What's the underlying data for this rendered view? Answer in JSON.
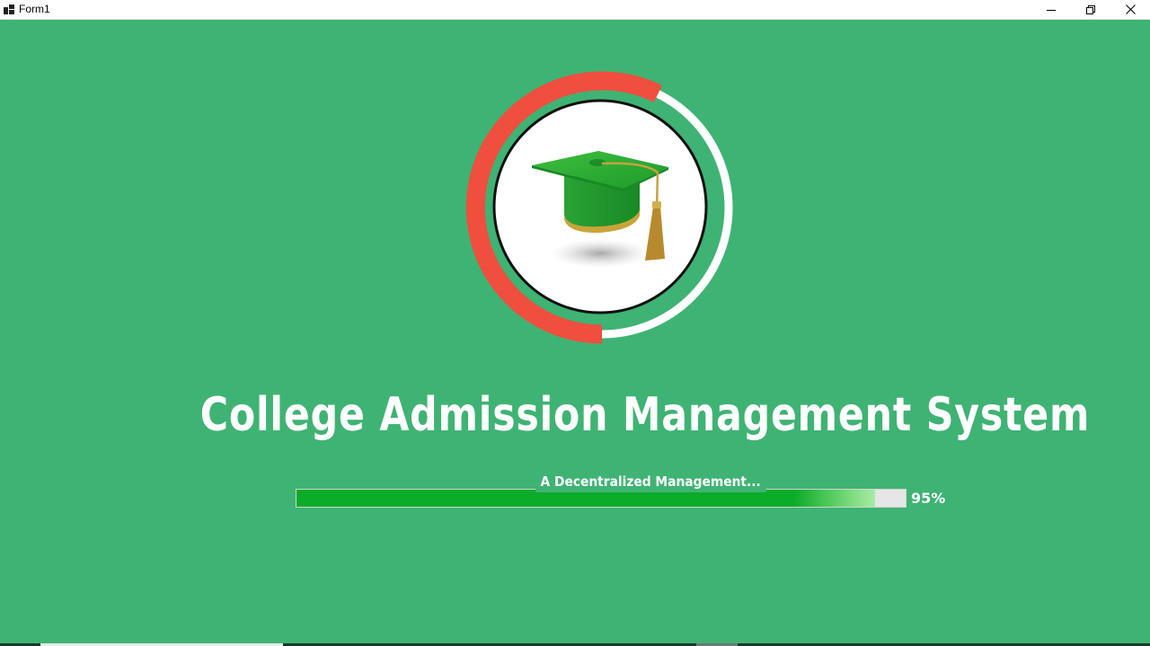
{
  "window": {
    "title": "Form1",
    "controls": [
      "minimize",
      "restore",
      "close"
    ]
  },
  "logo": {
    "icon": "graduation-cap-icon",
    "ring_colors": {
      "loaded": "#f04e3e",
      "remaining": "#ffffff"
    }
  },
  "splash": {
    "title": "College Admission Management System",
    "subtitle": "A Decentralized Management...",
    "progress_value": 95,
    "progress_label": "95%"
  },
  "colors": {
    "background": "#3fb373",
    "progress_fill": "#0bac29",
    "progress_track": "#e6e6e6"
  }
}
